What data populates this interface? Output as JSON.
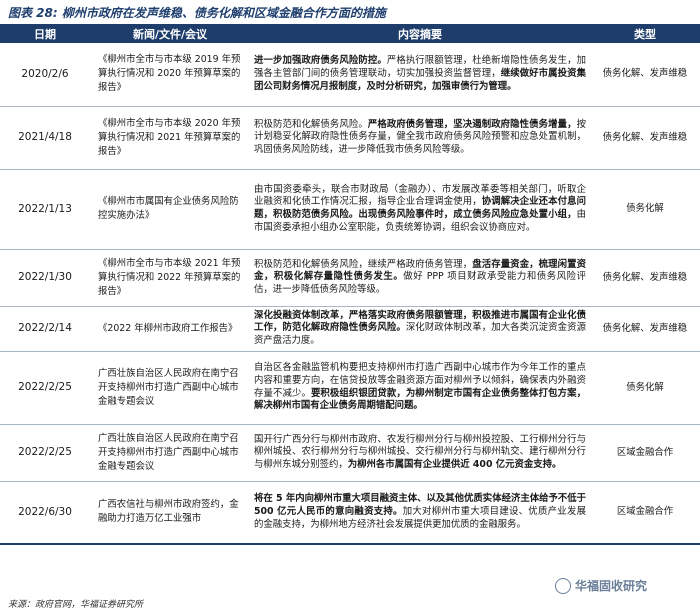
{
  "title": "图表 28: 柳州市政府在发声维稳、债务化解和区域金融合作方面的措施",
  "columns": [
    "日期",
    "新闻/文件/会议",
    "内容摘要",
    "类型"
  ],
  "rows": [
    {
      "date": "2020/2/6",
      "news": "《柳州市全市与市本级 2019 年预算执行情况和 2020 年预算草案的报告》",
      "summary": [
        {
          "t": "进一步加强政府债务风险防控。",
          "b": true
        },
        {
          "t": "严格执行限额管理，杜绝新增隐性债务发生，加强各主管部门间的债务管理联动，切实加强投资监督管理，",
          "b": false
        },
        {
          "t": "继续做好市属投资集团公司财务情况月报制度，及时分析研究，加强审债行为管理。",
          "b": true
        }
      ],
      "type": "债务化解、发声维稳"
    },
    {
      "date": "2021/4/18",
      "news": "《柳州市全市与市本级 2020 年预算执行情况和 2021 年预算草案的报告》",
      "summary": [
        {
          "t": "积极防范和化解债务风险。",
          "b": false
        },
        {
          "t": "严格政府债务管理，坚决遏制政府隐性债务增量，",
          "b": true
        },
        {
          "t": "按计划稳妥化解政府隐性债务存量，健全我市政府债务风险预警和应急处置机制，巩固债务风险防线，进一步降低我市债务风险等级。",
          "b": false
        }
      ],
      "type": "债务化解、发声维稳"
    },
    {
      "date": "2022/1/13",
      "news": "《柳州市市属国有企业债务风险防控实施办法》",
      "summary": [
        {
          "t": "由市国资委牵头，联合市财政局（金融办）、市发展改革委等相关部门，听取企业融资和化债工作情况汇报，指导企业合理调金使用，",
          "b": false
        },
        {
          "t": "协调解决企业还本付息问题，积极防范债务风险。出现债务风险事件时，成立债务风险应急处置小组，",
          "b": true
        },
        {
          "t": "由市国资委承担小组办公室职能，负责统筹协调，组织会议协商应对。",
          "b": false
        }
      ],
      "type": "债务化解"
    },
    {
      "date": "2022/1/30",
      "news": "《柳州市全市与市本级 2021 年预算执行情况和 2022 年预算草案的报告》",
      "summary": [
        {
          "t": "积极防范和化解债务风险，继续严格政府债务管理，",
          "b": false
        },
        {
          "t": "盘活存量资金，梳理闲置资金，积极化解存量隐性债务发生。",
          "b": true
        },
        {
          "t": "做好 PPP 项目财政承受能力和债务风险评估，进一步降低债务风险等级。",
          "b": false
        }
      ],
      "type": "债务化解、发声维稳"
    },
    {
      "date": "2022/2/14",
      "news": "《2022 年柳州市政府工作报告》",
      "summary": [
        {
          "t": "深化投融资体制改革，严格落实政府债务限额管理，积极推进市属国有企业化债工作，防范化解政府隐性债务风险。",
          "b": true
        },
        {
          "t": "深化财政体制改革，加大各类沉淀资金资源资产盘活力度。",
          "b": false
        }
      ],
      "type": "债务化解、发声维稳"
    },
    {
      "date": "2022/2/25",
      "news": "广西壮族自治区人民政府在南宁召开支持柳州市打造广西副中心城市金融专题会议",
      "summary": [
        {
          "t": "自治区各金融监管机构要把支持柳州市打造广西副中心城市作为今年工作的重点内容和重要方向，在信贷投放等金融资源方面对柳州予以倾斜，确保表内外融资存量不减少。",
          "b": false
        },
        {
          "t": "要积极组织银团贷款，为柳州制定市国有企业债务整体打包方案，解决柳州市国有企业债务周期错配问题。",
          "b": true
        }
      ],
      "type": "债务化解"
    },
    {
      "date": "2022/2/25",
      "news": "广西壮族自治区人民政府在南宁召开支持柳州市打造广西副中心城市金融专题会议",
      "summary": [
        {
          "t": "国开行广西分行与柳州市政府、农发行柳州分行与柳州投控股、工行柳州分行与柳州城投、农行柳州分行与柳州城投、交行柳州分行与柳州轨交、建行柳州分行与柳州东城分别签约，",
          "b": false
        },
        {
          "t": "为柳州各市属国有企业提供近 400 亿元资金支持。",
          "b": true
        }
      ],
      "type": "区域金融合作"
    },
    {
      "date": "2022/6/30",
      "news": "广西农信社与柳州市政府签约，金融助力打造万亿工业强市",
      "summary": [
        {
          "t": "将在 5 年内向柳州市重大项目融资主体、以及其他优质实体经济主体给予不低于 500 亿元人民币的意向融资支持。",
          "b": true
        },
        {
          "t": "加大对柳州市重大项目建设、优质产业发展的金融支持，为柳州地方经济社会发展提供更加优质的金融服务。",
          "b": false
        }
      ],
      "type": "区域金融合作"
    }
  ],
  "source": "来源：政府官网，华福证券研究所",
  "watermark": "华福固收研究"
}
